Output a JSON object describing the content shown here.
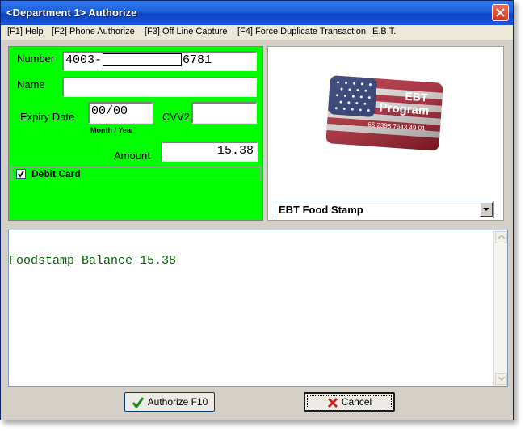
{
  "window": {
    "title": "<Department 1> Authorize"
  },
  "menu": [
    "[F1] Help",
    "[F2] Phone Authorize",
    "[F3] Off Line Capture",
    "[F4] Force Duplicate Transaction",
    "E.B.T."
  ],
  "form": {
    "number_label": "Number",
    "number_prefix": "4003-",
    "number_suffix": "6781",
    "name_label": "Name",
    "name_value": "",
    "expiry_label": "Expiry Date",
    "expiry_value": "00/00",
    "expiry_hint": "Month / Year",
    "cvv_label": "CVV2",
    "cvv_value": "",
    "amount_label": "Amount",
    "amount_value": "15.38",
    "debit_label": "Debit Card",
    "debit_checked": true
  },
  "card_image": {
    "title_line1": "EBT",
    "title_line2": "Program",
    "number": "65 2398 7643 49 01"
  },
  "card_type": {
    "selected": "EBT Food Stamp"
  },
  "output": {
    "text": "Foodstamp Balance 15.38"
  },
  "buttons": {
    "authorize": "Authorize F10",
    "cancel": "Cancel"
  },
  "colors": {
    "form_bg": "#00ff00",
    "output_text": "#006400",
    "titlebar": "#0b45c8"
  }
}
